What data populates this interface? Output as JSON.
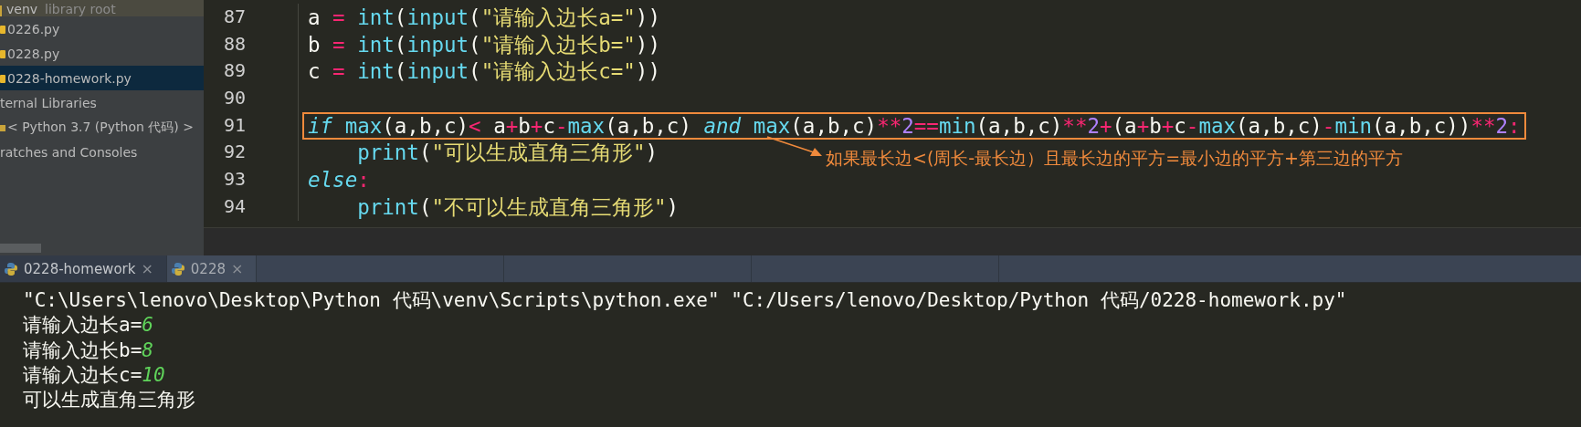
{
  "project_tree": [
    {
      "kind": "root",
      "label": "venv",
      "note": "library root",
      "selected": false
    },
    {
      "kind": "file",
      "label": "0226.py",
      "selected": false
    },
    {
      "kind": "file",
      "label": "0228.py",
      "selected": false
    },
    {
      "kind": "file",
      "label": "0228-homework.py",
      "selected": true
    },
    {
      "kind": "plain",
      "label": "ternal Libraries",
      "selected": false
    },
    {
      "kind": "library",
      "label": "< Python 3.7 (Python 代码) >",
      "selected": false
    },
    {
      "kind": "plain",
      "label": "ratches and Consoles",
      "selected": false
    }
  ],
  "editor": {
    "lines": [
      {
        "number": "87",
        "boxed": false,
        "tokens": [
          {
            "kind": "plain",
            "text": "a "
          },
          {
            "kind": "op",
            "text": "= "
          },
          {
            "kind": "builtin",
            "text": "int"
          },
          {
            "kind": "plain",
            "text": "("
          },
          {
            "kind": "builtin",
            "text": "input"
          },
          {
            "kind": "plain",
            "text": "("
          },
          {
            "kind": "string",
            "text": "\"请输入边长a=\""
          },
          {
            "kind": "plain",
            "text": "))"
          }
        ]
      },
      {
        "number": "88",
        "boxed": false,
        "tokens": [
          {
            "kind": "plain",
            "text": "b "
          },
          {
            "kind": "op",
            "text": "= "
          },
          {
            "kind": "builtin",
            "text": "int"
          },
          {
            "kind": "plain",
            "text": "("
          },
          {
            "kind": "builtin",
            "text": "input"
          },
          {
            "kind": "plain",
            "text": "("
          },
          {
            "kind": "string",
            "text": "\"请输入边长b=\""
          },
          {
            "kind": "plain",
            "text": "))"
          }
        ]
      },
      {
        "number": "89",
        "boxed": false,
        "tokens": [
          {
            "kind": "plain",
            "text": "c "
          },
          {
            "kind": "op",
            "text": "= "
          },
          {
            "kind": "builtin",
            "text": "int"
          },
          {
            "kind": "plain",
            "text": "("
          },
          {
            "kind": "builtin",
            "text": "input"
          },
          {
            "kind": "plain",
            "text": "("
          },
          {
            "kind": "string",
            "text": "\"请输入边长c=\""
          },
          {
            "kind": "plain",
            "text": "))"
          }
        ]
      },
      {
        "number": "90",
        "boxed": false
      },
      {
        "number": "91",
        "boxed": true,
        "tokens": [
          {
            "kind": "keyword",
            "text": "if "
          },
          {
            "kind": "builtin",
            "text": "max"
          },
          {
            "kind": "plain",
            "text": "(a,b,c)"
          },
          {
            "kind": "op",
            "text": "<"
          },
          {
            "kind": "plain",
            "text": " a"
          },
          {
            "kind": "op",
            "text": "+"
          },
          {
            "kind": "plain",
            "text": "b"
          },
          {
            "kind": "op",
            "text": "+"
          },
          {
            "kind": "plain",
            "text": "c"
          },
          {
            "kind": "op",
            "text": "-"
          },
          {
            "kind": "builtin",
            "text": "max"
          },
          {
            "kind": "plain",
            "text": "(a,b,c) "
          },
          {
            "kind": "keyword",
            "text": "and "
          },
          {
            "kind": "builtin",
            "text": "max"
          },
          {
            "kind": "plain",
            "text": "(a,b,c)"
          },
          {
            "kind": "op",
            "text": "**"
          },
          {
            "kind": "number",
            "text": "2"
          },
          {
            "kind": "op",
            "text": "=="
          },
          {
            "kind": "builtin",
            "text": "min"
          },
          {
            "kind": "plain",
            "text": "(a,b,c)"
          },
          {
            "kind": "op",
            "text": "**"
          },
          {
            "kind": "number",
            "text": "2"
          },
          {
            "kind": "op",
            "text": "+"
          },
          {
            "kind": "plain",
            "text": "(a"
          },
          {
            "kind": "op",
            "text": "+"
          },
          {
            "kind": "plain",
            "text": "b"
          },
          {
            "kind": "op",
            "text": "+"
          },
          {
            "kind": "plain",
            "text": "c"
          },
          {
            "kind": "op",
            "text": "-"
          },
          {
            "kind": "builtin",
            "text": "max"
          },
          {
            "kind": "plain",
            "text": "(a,b,c)"
          },
          {
            "kind": "op",
            "text": "-"
          },
          {
            "kind": "builtin",
            "text": "min"
          },
          {
            "kind": "plain",
            "text": "(a,b,c))"
          },
          {
            "kind": "op",
            "text": "**"
          },
          {
            "kind": "number",
            "text": "2"
          },
          {
            "kind": "op",
            "text": ":"
          }
        ]
      },
      {
        "number": "92",
        "boxed": false,
        "tokens": [
          {
            "kind": "builtin",
            "text": "    print"
          },
          {
            "kind": "plain",
            "text": "("
          },
          {
            "kind": "string",
            "text": "\"可以生成直角三角形\""
          },
          {
            "kind": "plain",
            "text": ")"
          }
        ]
      },
      {
        "number": "93",
        "boxed": false,
        "tokens": [
          {
            "kind": "keyword",
            "text": "else"
          },
          {
            "kind": "op",
            "text": ":"
          }
        ]
      },
      {
        "number": "94",
        "boxed": false,
        "tokens": [
          {
            "kind": "builtin",
            "text": "    print"
          },
          {
            "kind": "plain",
            "text": "("
          },
          {
            "kind": "string",
            "text": "\"不可以生成直角三角形\""
          },
          {
            "kind": "plain",
            "text": ")"
          }
        ]
      }
    ],
    "annotation": "如果最长边<(周长-最长边）且最长边的平方=最小边的平方+第三边的平方"
  },
  "run_tabs": [
    {
      "label": "0228-homework",
      "selected": true
    },
    {
      "label": "0228",
      "selected": false
    }
  ],
  "close_label": "×",
  "console": [
    {
      "tokens": [
        {
          "kind": "plain",
          "text": "\"C:\\Users\\lenovo\\Desktop\\Python 代码\\venv\\Scripts\\python.exe\" \"C:/Users/lenovo/Desktop/Python 代码/0228-homework.py\""
        }
      ]
    },
    {
      "tokens": [
        {
          "kind": "plain",
          "text": "请输入边长a="
        },
        {
          "kind": "input",
          "text": "6"
        }
      ]
    },
    {
      "tokens": [
        {
          "kind": "plain",
          "text": "请输入边长b="
        },
        {
          "kind": "input",
          "text": "8"
        }
      ]
    },
    {
      "tokens": [
        {
          "kind": "plain",
          "text": "请输入边长c="
        },
        {
          "kind": "input",
          "text": "10"
        }
      ]
    },
    {
      "tokens": [
        {
          "kind": "plain",
          "text": "可以生成直角三角形"
        }
      ]
    }
  ]
}
